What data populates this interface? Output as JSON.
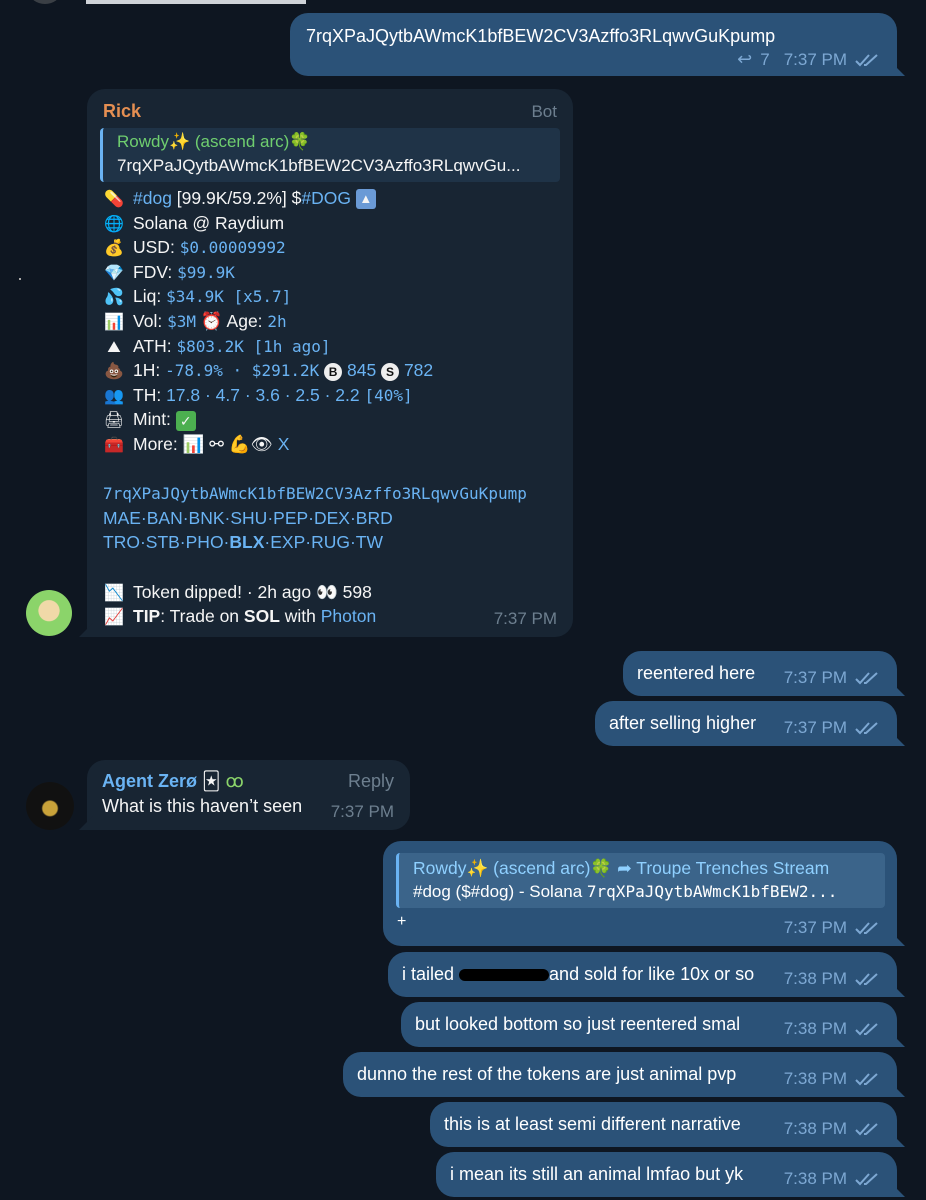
{
  "messages": {
    "m1": {
      "text": "7rqXPaJQytbAWmcK1bfBEW2CV3Azffo3RLqwvGuKpump",
      "reply_count": "7",
      "time": "7:37 PM"
    },
    "bot": {
      "sender": "Rick",
      "badge": "Bot",
      "quote_title": "Rowdy✨ (ascend arc)🍀",
      "quote_text": "7rqXPaJQytbAWmcK1bfBEW2CV3Azffo3RLqwvGu...",
      "line1": {
        "tag": "#dog",
        "stats": " [99.9K/59.2%] $",
        "ticker": "#DOG"
      },
      "chain": "Solana @ Raydium",
      "usd_label": "USD: ",
      "usd": "$0.00009992",
      "fdv_label": "FDV: ",
      "fdv": "$99.9K",
      "liq_label": "Liq: ",
      "liq": "$34.9K [x5.7]",
      "vol_label": "Vol: ",
      "vol": "$3M",
      "age_label": " Age: ",
      "age": "2h",
      "ath_label": "ATH: ",
      "ath": "$803.2K [1h ago]",
      "h1_label": "1H: ",
      "h1": "-78.9% · $291.2K",
      "h1_b": "845",
      "h1_s": "782",
      "th_label": "TH: ",
      "th": "17.8 · 4.7 · 3.6 · 2.5 · 2.2",
      "th_pct": "[40%]",
      "mint_label": "Mint: ",
      "more_label": "More: ",
      "more_x": "X",
      "address": "7rqXPaJQytbAWmcK1bfBEW2CV3Azffo3RLqwvGuKpump",
      "links1": "MAE·BAN·BNK·SHU·PEP·DEX·BRD",
      "links2a": "TRO·STB·PHO·",
      "links2b": "BLX",
      "links2c": "·EXP·RUG·TW",
      "dipped": "Token dipped! · 2h ago",
      "views": "598",
      "tip_label": "TIP",
      "tip_1": ": Trade on ",
      "tip_sol": "SOL",
      "tip_2": " with ",
      "tip_link": "Photon",
      "time": "7:37 PM"
    },
    "m3": {
      "text": "reentered here",
      "time": "7:37 PM"
    },
    "m4": {
      "text": "after selling higher",
      "time": "7:37 PM"
    },
    "agent": {
      "sender": "Agent Zerø",
      "reply_label": "Reply",
      "text": "What is this haven’t seen",
      "time": "7:37 PM"
    },
    "m6": {
      "quote_title": "Rowdy✨ (ascend arc)🍀",
      "forward_label": "Troupe Trenches Stream",
      "quote_text_a": "#dog ($#dog) - Solana ",
      "quote_text_b": "7rqXPaJQytbAWmcK1bfBEW2...",
      "text": "+",
      "time": "7:37 PM"
    },
    "m7": {
      "text_a": "i tailed ",
      "text_b": "and sold for like 10x or so",
      "time": "7:38 PM"
    },
    "m8": {
      "text": "but looked bottom so just reentered smal",
      "time": "7:38 PM"
    },
    "m9": {
      "text": "dunno the rest of the tokens are just animal pvp",
      "time": "7:38 PM"
    },
    "m10": {
      "text": "this is at least semi different narrative",
      "time": "7:38 PM"
    },
    "m11": {
      "text": "i mean its still an animal lmfao but yk",
      "time": "7:38 PM"
    }
  },
  "colors": {
    "background": "#0e1621",
    "outgoing": "#2b5278",
    "incoming": "#182533",
    "accent": "#6ab3f3",
    "bot_name": "#e58f52"
  }
}
